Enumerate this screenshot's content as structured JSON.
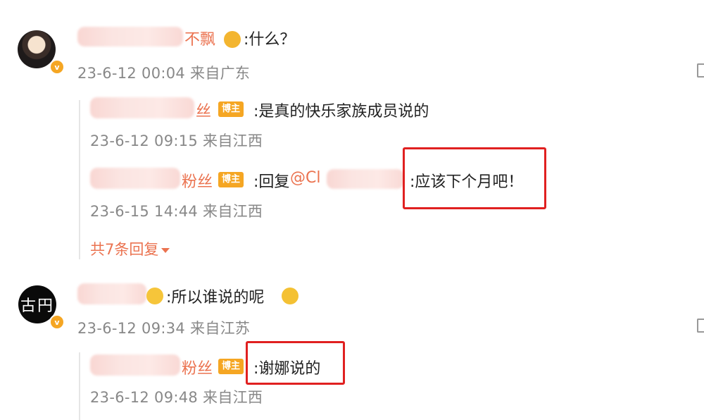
{
  "comments": [
    {
      "name_visible": "不飘",
      "text": ":什么？",
      "meta": "23-6-12 00:04 来自广东",
      "replies": [
        {
          "name_visible": "丝",
          "tag": "博主",
          "text": ":是真的快乐家族成员说的",
          "meta": "23-6-12 09:15 来自江西"
        },
        {
          "name_visible": "粉丝",
          "tag": "博主",
          "text_prefix": ":回复",
          "mention": "@Cl",
          "text": ":应该下个月吧！",
          "meta": "23-6-15 14:44 来自江西"
        }
      ],
      "more_replies": "共7条回复"
    },
    {
      "avatar_text": "古円",
      "text": ":所以谁说的呢",
      "meta": "23-6-12 09:34 来自江苏",
      "replies": [
        {
          "name_visible": "粉丝",
          "tag": "博主",
          "text": ":谢娜说的",
          "meta": "23-6-12 09:48 来自江西"
        }
      ]
    }
  ],
  "colors": {
    "accent": "#eb7350",
    "highlight_box": "#e02020",
    "badge": "#f5a623"
  },
  "icons": {
    "verified": "v-badge-icon",
    "crown": "crown-emoji-icon",
    "laugh": "laughing-emoji-icon",
    "caret": "caret-down-icon"
  }
}
